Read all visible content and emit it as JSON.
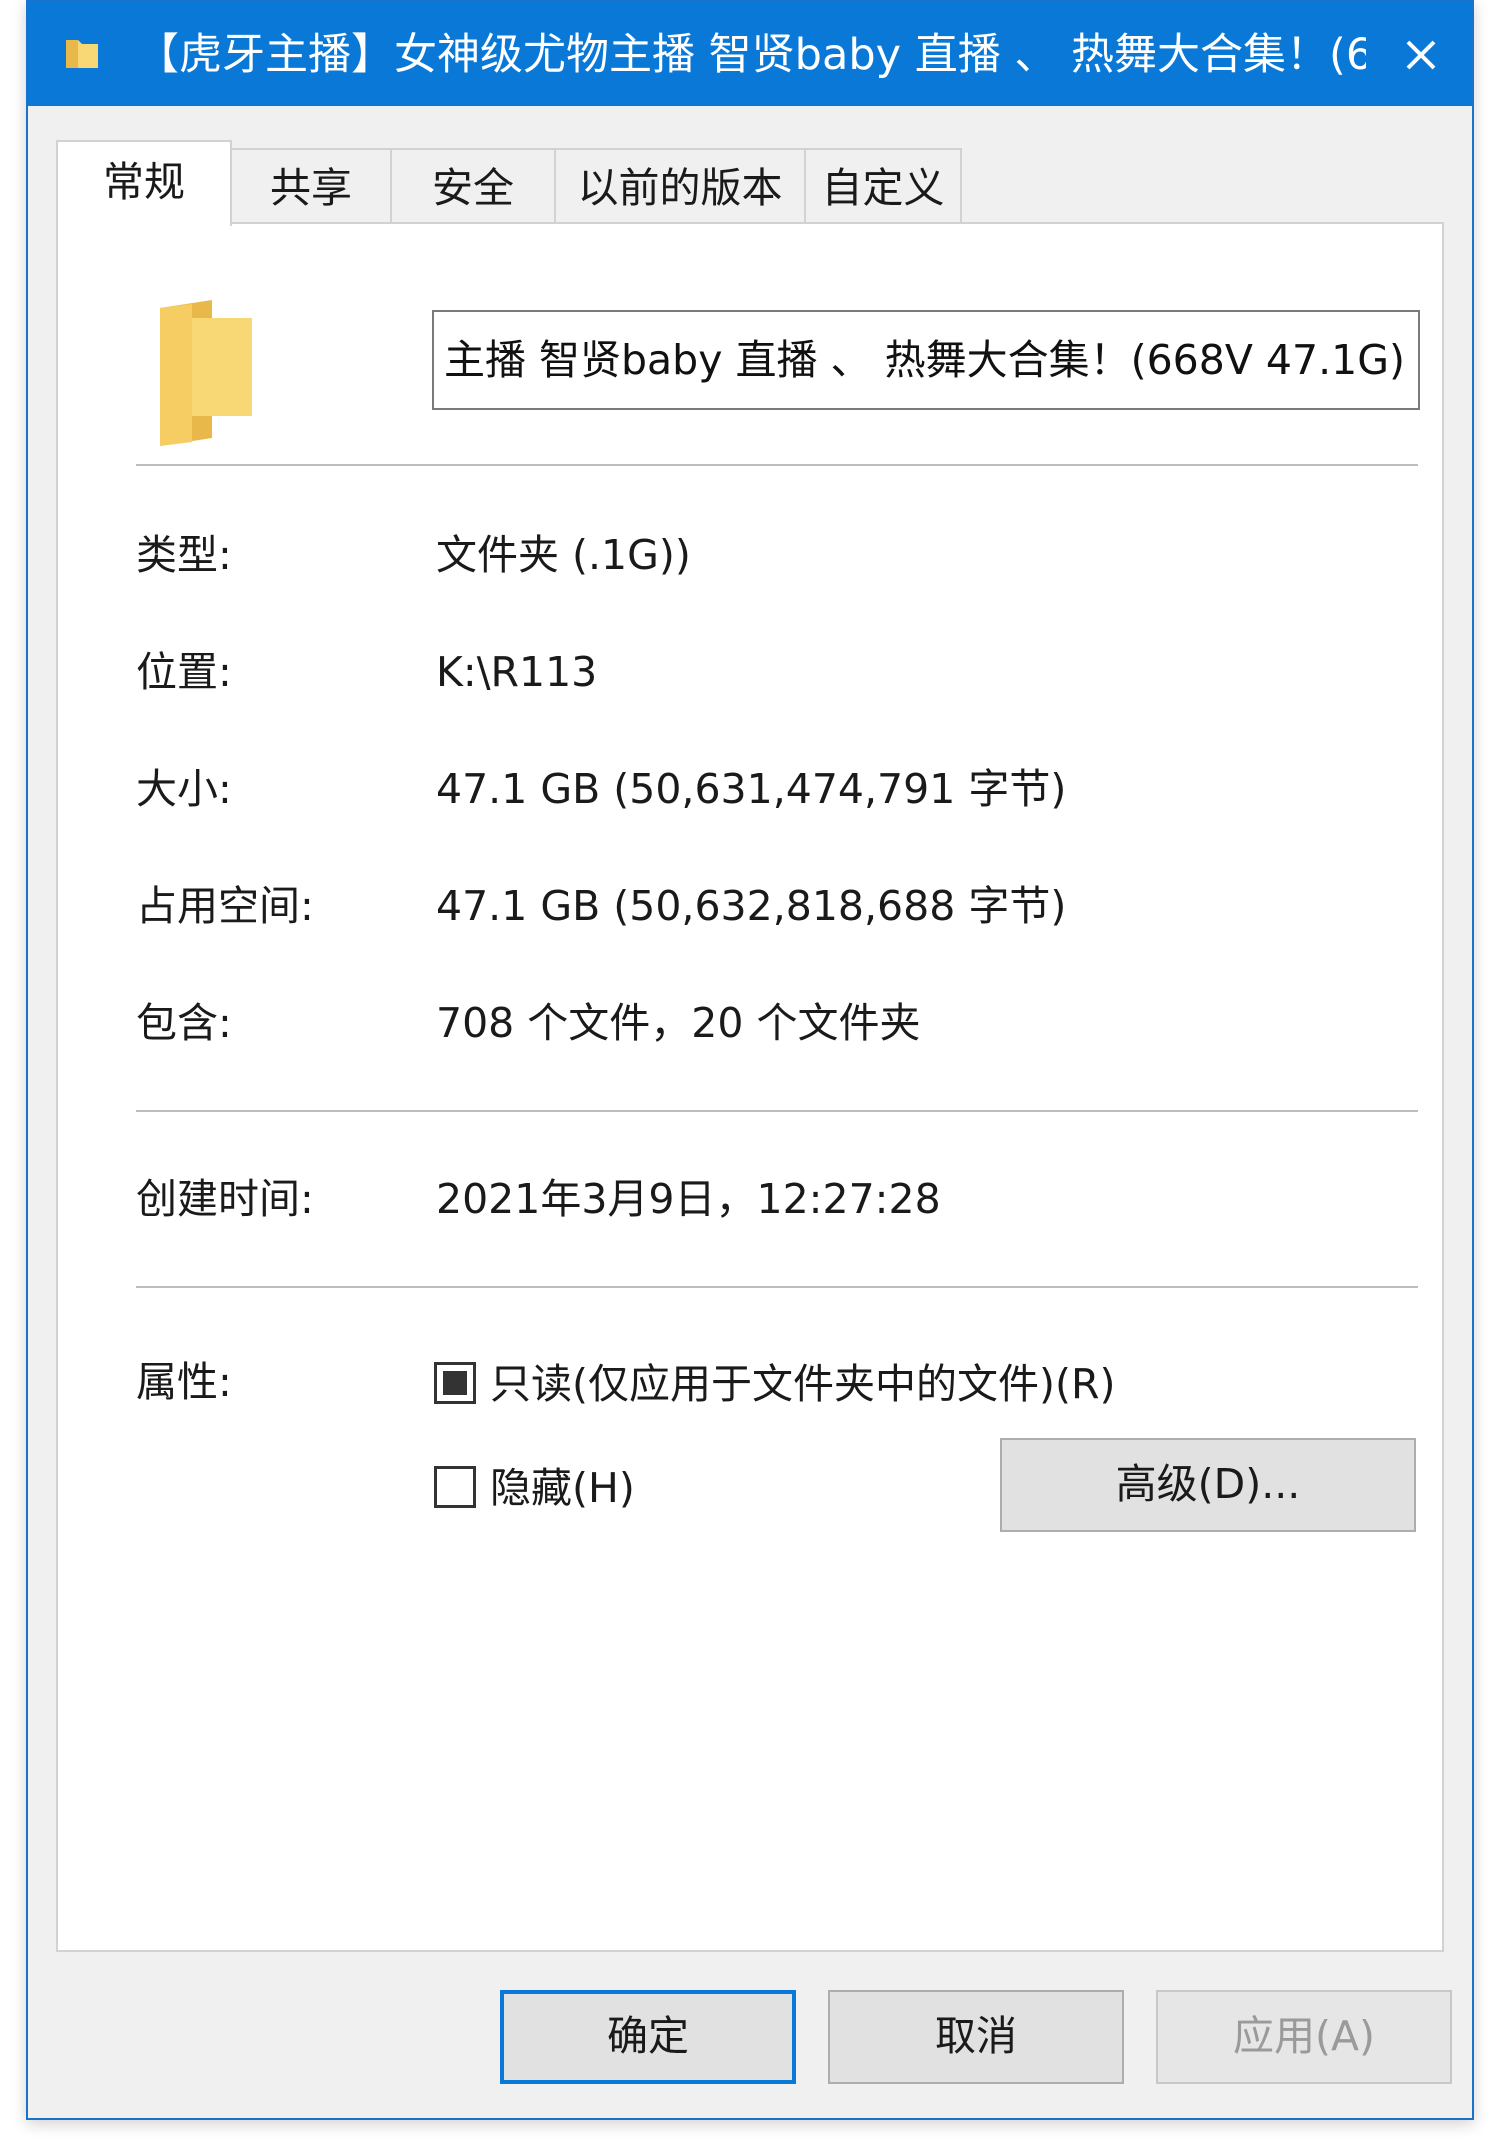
{
  "window": {
    "title": "【虎牙主播】女神级尤物主播 智贤baby 直播 、 热舞大合集！(6..."
  },
  "tabs": [
    {
      "label": "常规",
      "active": true
    },
    {
      "label": "共享",
      "active": false
    },
    {
      "label": "安全",
      "active": false
    },
    {
      "label": "以前的版本",
      "active": false
    },
    {
      "label": "自定义",
      "active": false
    }
  ],
  "general": {
    "folder_name": "主播 智贤baby 直播 、 热舞大合集！(668V 47.1G)",
    "rows": [
      {
        "label": "类型:",
        "value": "文件夹 (.1G))"
      },
      {
        "label": "位置:",
        "value": "K:\\R113"
      },
      {
        "label": "大小:",
        "value": "47.1 GB (50,631,474,791 字节)"
      },
      {
        "label": "占用空间:",
        "value": "47.1 GB (50,632,818,688 字节)"
      },
      {
        "label": "包含:",
        "value": "708 个文件，20 个文件夹"
      }
    ],
    "created": {
      "label": "创建时间:",
      "value": "2021年3月9日，12:27:28"
    },
    "attributes": {
      "label": "属性:",
      "readonly": {
        "label": "只读(仅应用于文件夹中的文件)(R)",
        "state": "indeterminate"
      },
      "hidden": {
        "label": "隐藏(H)",
        "state": "unchecked"
      },
      "advanced_button": "高级(D)..."
    }
  },
  "footer": {
    "ok": "确定",
    "cancel": "取消",
    "apply": "应用(A)"
  },
  "icons": {
    "title_icon": "folder-icon",
    "close_icon": "close-icon",
    "panel_icon": "folder-icon"
  },
  "colors": {
    "titlebar": "#0a78d7",
    "folder_light": "#f8d775",
    "folder_dark": "#e8b94a"
  }
}
